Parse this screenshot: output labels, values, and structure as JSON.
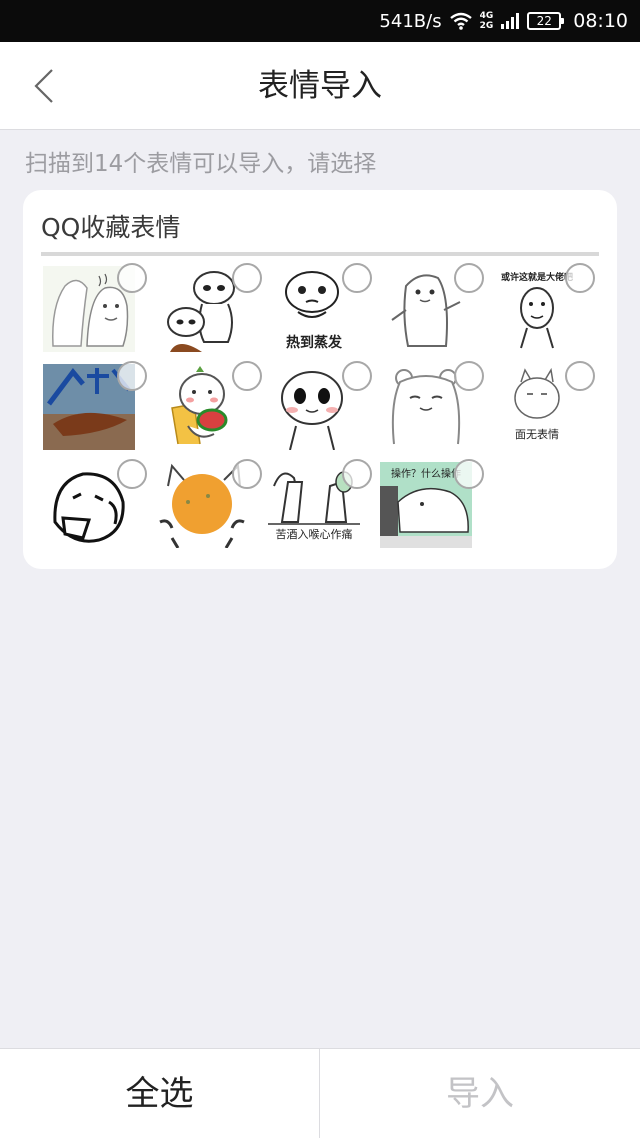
{
  "status_bar": {
    "net_speed": "541B/s",
    "net_4g": "4G",
    "net_2g": "2G",
    "battery": "22",
    "time": "08:10"
  },
  "nav": {
    "title": "表情导入",
    "back_icon": "chevron-left-icon"
  },
  "hint": "扫描到14个表情可以导入，请选择",
  "group": {
    "title": "QQ收藏表情",
    "stickers": [
      {
        "caption": ""
      },
      {
        "caption": ""
      },
      {
        "caption": "热到蒸发"
      },
      {
        "caption": ""
      },
      {
        "caption": "或许这就是大佬吧"
      },
      {
        "caption": ""
      },
      {
        "caption": ""
      },
      {
        "caption": ""
      },
      {
        "caption": ""
      },
      {
        "caption": "面无表情"
      },
      {
        "caption": ""
      },
      {
        "caption": ""
      },
      {
        "caption": "苦酒入喉心作痛"
      },
      {
        "caption": "操作？什么操作"
      }
    ],
    "selected_count": 0
  },
  "bottom": {
    "select_all": "全选",
    "import": "导入"
  },
  "colors": {
    "background": "#efeff4",
    "card": "#ffffff",
    "hint_text": "#9c9ca1",
    "import_disabled": "#c3c3c6"
  }
}
